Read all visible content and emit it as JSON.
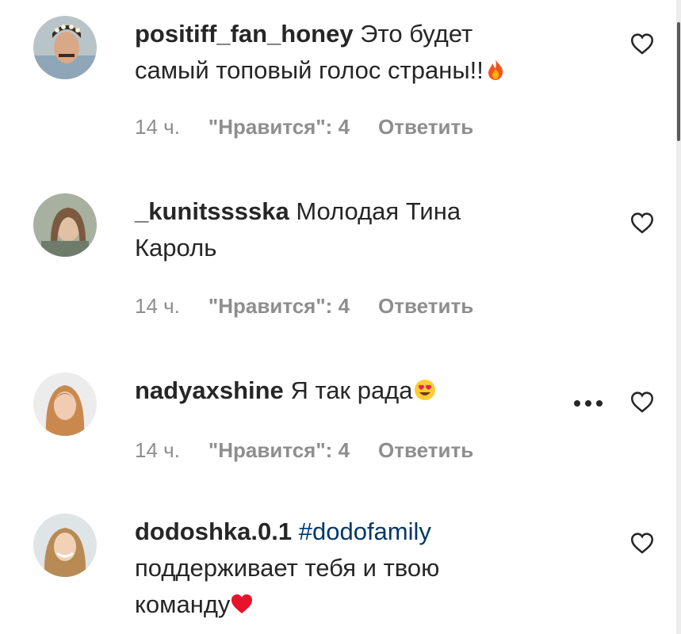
{
  "comments": [
    {
      "username": "positiff_fan_honey",
      "line1": "Это будет",
      "line2": "самый топовый голос страны!!",
      "emoji": "fire-emoji",
      "time": "14 ч.",
      "likes": "\"Нравится\": 4",
      "reply": "Ответить"
    },
    {
      "username": "_kunitsssska",
      "line1": "Молодая Тина",
      "line2": "Кароль",
      "time": "14 ч.",
      "likes": "\"Нравится\": 4",
      "reply": "Ответить"
    },
    {
      "username": "nadyaxshine",
      "line1": "Я так рада",
      "emoji": "heart-eyes-emoji",
      "time": "14 ч.",
      "likes": "\"Нравится\": 4",
      "reply": "Ответить"
    },
    {
      "username": "dodoshka.0.1",
      "hashtag": "#dodofamily",
      "line2": "поддерживает тебя и твою",
      "line3": "команду",
      "emoji": "red-heart-emoji"
    }
  ],
  "icons": {
    "like": "heart-outline-icon",
    "more": "more-options-icon"
  },
  "colors": {
    "text": "#262626",
    "secondary": "#8e8e8e",
    "hashtag": "#00376b"
  }
}
